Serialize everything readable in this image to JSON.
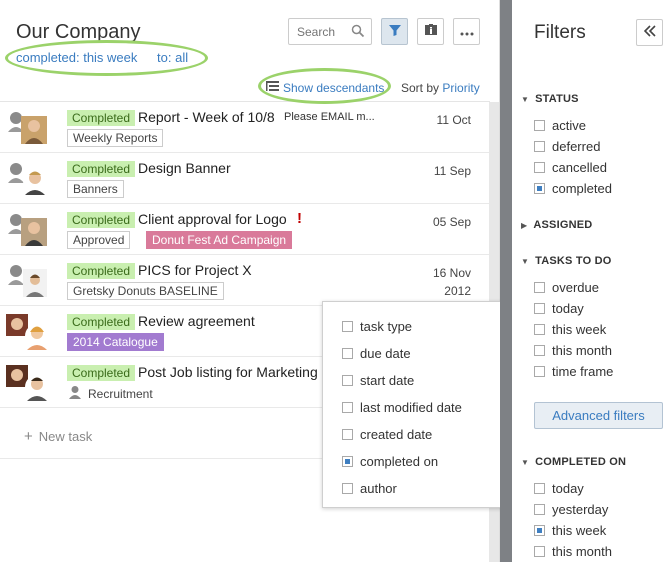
{
  "header": {
    "title": "Our Company",
    "filter_completed": "completed: this week",
    "filter_to": "to: all",
    "search_placeholder": "Search"
  },
  "sortbar": {
    "show_descendants": "Show descendants",
    "sort_by": "Sort by",
    "sort_value": "Priority"
  },
  "tasks": [
    {
      "status": "Completed",
      "name": "Report - Week of 10/8",
      "note": "Please EMAIL m...",
      "date": "11 Oct",
      "tag": "Weekly Reports"
    },
    {
      "status": "Completed",
      "name": "Design Banner",
      "date": "11 Sep",
      "tag": "Banners"
    },
    {
      "status": "Completed",
      "name": "Client approval for Logo",
      "date": "05 Sep",
      "tag": "Approved",
      "tag2": "Donut Fest Ad Campaign",
      "tag2_color": "#d97a9a",
      "priority_mark": "!"
    },
    {
      "status": "Completed",
      "name": "PICS for Project X",
      "date": "16 Nov",
      "date2": "2012",
      "tag": "Gretsky Donuts BASELINE"
    },
    {
      "status": "Completed",
      "name": "Review agreement",
      "tag2": "2014 Catalogue",
      "tag2_color": "#a27bd0"
    },
    {
      "status": "Completed",
      "name": "Post Job listing for Marketing a",
      "tag": "Recruitment"
    }
  ],
  "new_task": "New task",
  "dropdown": {
    "items": [
      {
        "label": "task type",
        "checked": false
      },
      {
        "label": "due date",
        "checked": false
      },
      {
        "label": "start date",
        "checked": false
      },
      {
        "label": "last modified date",
        "checked": false
      },
      {
        "label": "created date",
        "checked": false
      },
      {
        "label": "completed on",
        "checked": true
      },
      {
        "label": "author",
        "checked": false
      }
    ]
  },
  "filters": {
    "title": "Filters",
    "status_header": "STATUS",
    "status_options": [
      {
        "label": "active",
        "checked": false
      },
      {
        "label": "deferred",
        "checked": false
      },
      {
        "label": "cancelled",
        "checked": false
      },
      {
        "label": "completed",
        "checked": true
      }
    ],
    "assigned_header": "ASSIGNED",
    "todo_header": "TASKS TO DO",
    "todo_options": [
      {
        "label": "overdue",
        "checked": false
      },
      {
        "label": "today",
        "checked": false
      },
      {
        "label": "this week",
        "checked": false
      },
      {
        "label": "this month",
        "checked": false
      },
      {
        "label": "time frame",
        "checked": false
      }
    ],
    "advanced": "Advanced filters",
    "completed_header": "COMPLETED ON",
    "completed_options": [
      {
        "label": "today",
        "checked": false
      },
      {
        "label": "yesterday",
        "checked": false
      },
      {
        "label": "this week",
        "checked": true
      },
      {
        "label": "this month",
        "checked": false
      }
    ]
  },
  "colors": {
    "accent": "#3a7cc0",
    "status_bg": "#c9efb0",
    "highlight": "#9bd26a",
    "divider": "#7e8185"
  }
}
